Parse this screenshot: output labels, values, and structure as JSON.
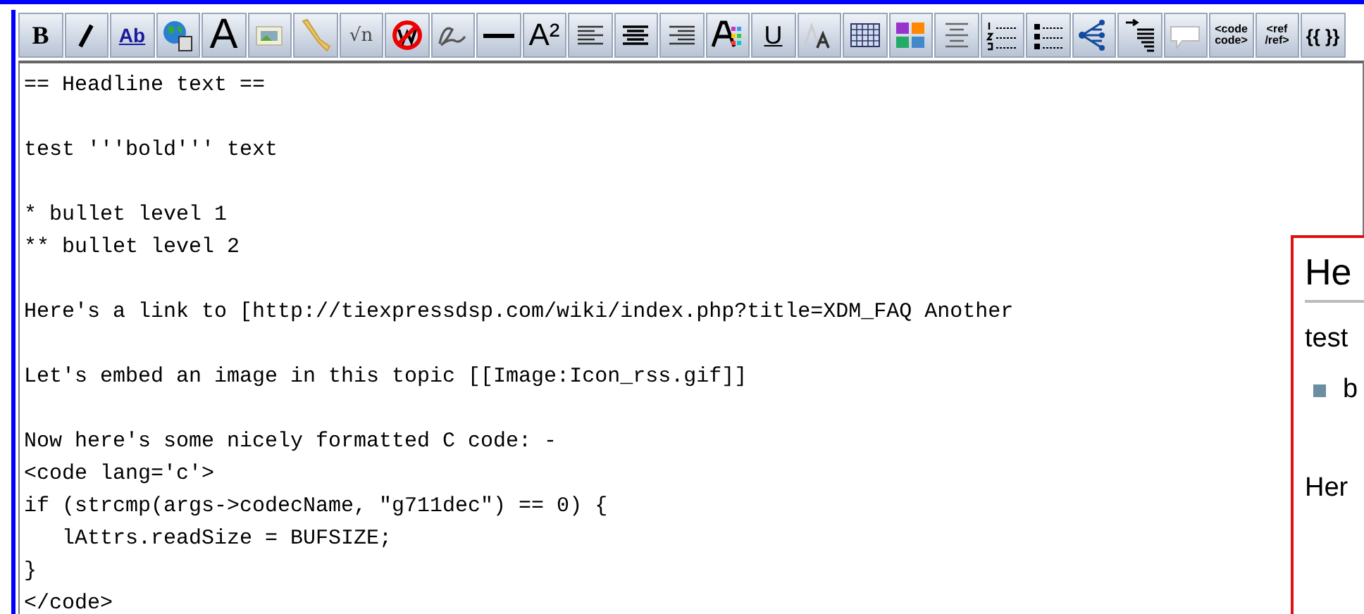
{
  "toolbar": {
    "buttons": [
      {
        "kind": "text",
        "label": "B"
      },
      {
        "kind": "icon"
      },
      {
        "kind": "text",
        "label": "Ab"
      },
      {
        "kind": "icon"
      },
      {
        "kind": "text",
        "label": "A"
      },
      {
        "kind": "icon"
      },
      {
        "kind": "icon"
      },
      {
        "kind": "text",
        "label": "√n"
      },
      {
        "kind": "icon"
      },
      {
        "kind": "icon"
      },
      {
        "kind": "icon"
      },
      {
        "kind": "text",
        "label": "A²"
      },
      {
        "kind": "icon"
      },
      {
        "kind": "icon"
      },
      {
        "kind": "icon"
      },
      {
        "kind": "icon"
      },
      {
        "kind": "text",
        "label": "U"
      },
      {
        "kind": "icon"
      },
      {
        "kind": "icon"
      },
      {
        "kind": "icon"
      },
      {
        "kind": "icon"
      },
      {
        "kind": "icon"
      },
      {
        "kind": "icon"
      },
      {
        "kind": "icon"
      },
      {
        "kind": "icon"
      },
      {
        "kind": "icon"
      },
      {
        "kind": "text",
        "label": "<code\ncode>"
      },
      {
        "kind": "text",
        "label": "<ref\n/ref>"
      },
      {
        "kind": "text",
        "label": "{{ }}"
      }
    ]
  },
  "editor": {
    "value": "== Headline text ==\n\ntest '''bold''' text\n\n* bullet level 1\n** bullet level 2\n\nHere's a link to [http://tiexpressdsp.com/wiki/index.php?title=XDM_FAQ Another\n\nLet's embed an image in this topic [[Image:Icon_rss.gif]]\n\nNow here's some nicely formatted C code: -\n<code lang='c'>\nif (strcmp(args->codecName, \"g711dec\") == 0) {\n   lAttrs.readSize = BUFSIZE;\n}\n</code>"
  },
  "preview": {
    "heading": "He",
    "paragraph": "test",
    "bullet": "b",
    "paragraph_2": "Her"
  }
}
